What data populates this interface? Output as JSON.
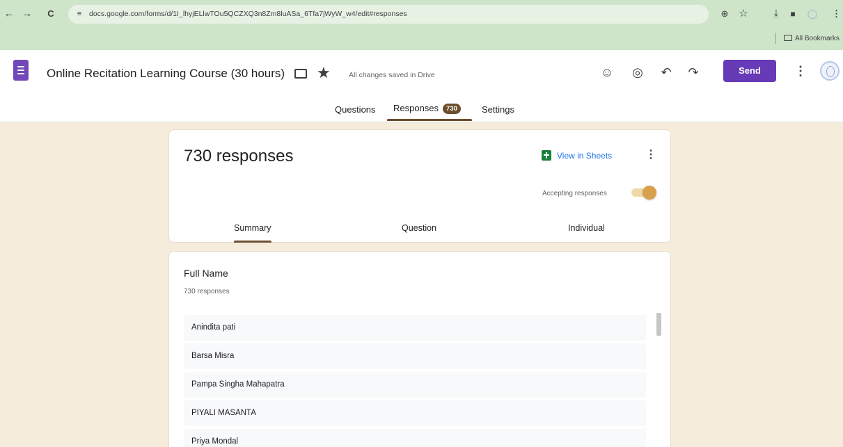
{
  "browser": {
    "back_icon": "←",
    "forward_icon": "→",
    "reload_icon": "C",
    "site_icon": "≡",
    "url": "docs.google.com/forms/d/1I_lhyjELlwTOu5QCZXQ3n8Zm8luASa_6Tfa7jWyW_w4/edit#responses",
    "zoom_icon": "⊕",
    "star_icon": "☆",
    "download_icon": "⤓",
    "sidebar_icon": "■",
    "profile_icon": "◯",
    "menu_icon": "⋮",
    "bookmarks_label": "All Bookmarks"
  },
  "header": {
    "form_title": "Online Recitation Learning Course (30 hours)",
    "star_icon": "★",
    "saved_status": "All changes saved in Drive",
    "palette_icon": "☺",
    "preview_icon": "◎",
    "undo_icon": "↶",
    "redo_icon": "↷",
    "send_label": "Send",
    "more_icon": "⋮"
  },
  "tabs": {
    "questions": "Questions",
    "responses": "Responses",
    "responses_count": "730",
    "settings": "Settings"
  },
  "summary_card": {
    "responses_heading": "730 responses",
    "view_in_sheets": "View in Sheets",
    "more_icon": "⋮",
    "accepting_label": "Accepting responses",
    "accepting_on": true,
    "sub_tabs": [
      "Summary",
      "Question",
      "Individual"
    ]
  },
  "question_card": {
    "title": "Full Name",
    "count": "730 responses",
    "answers": [
      "Anindita pati",
      "Barsa Misra",
      "Pampa Singha Mahapatra",
      "PIYALI MASANTA",
      "Priya Mondal"
    ]
  },
  "colors": {
    "browser_bar": "#cfe5c9",
    "page_background": "#f5ecdc",
    "accent_brown": "#6b4e2e",
    "send_purple": "#673ab7",
    "toggle_orange": "#d8a14d",
    "sheets_green": "#188038"
  }
}
